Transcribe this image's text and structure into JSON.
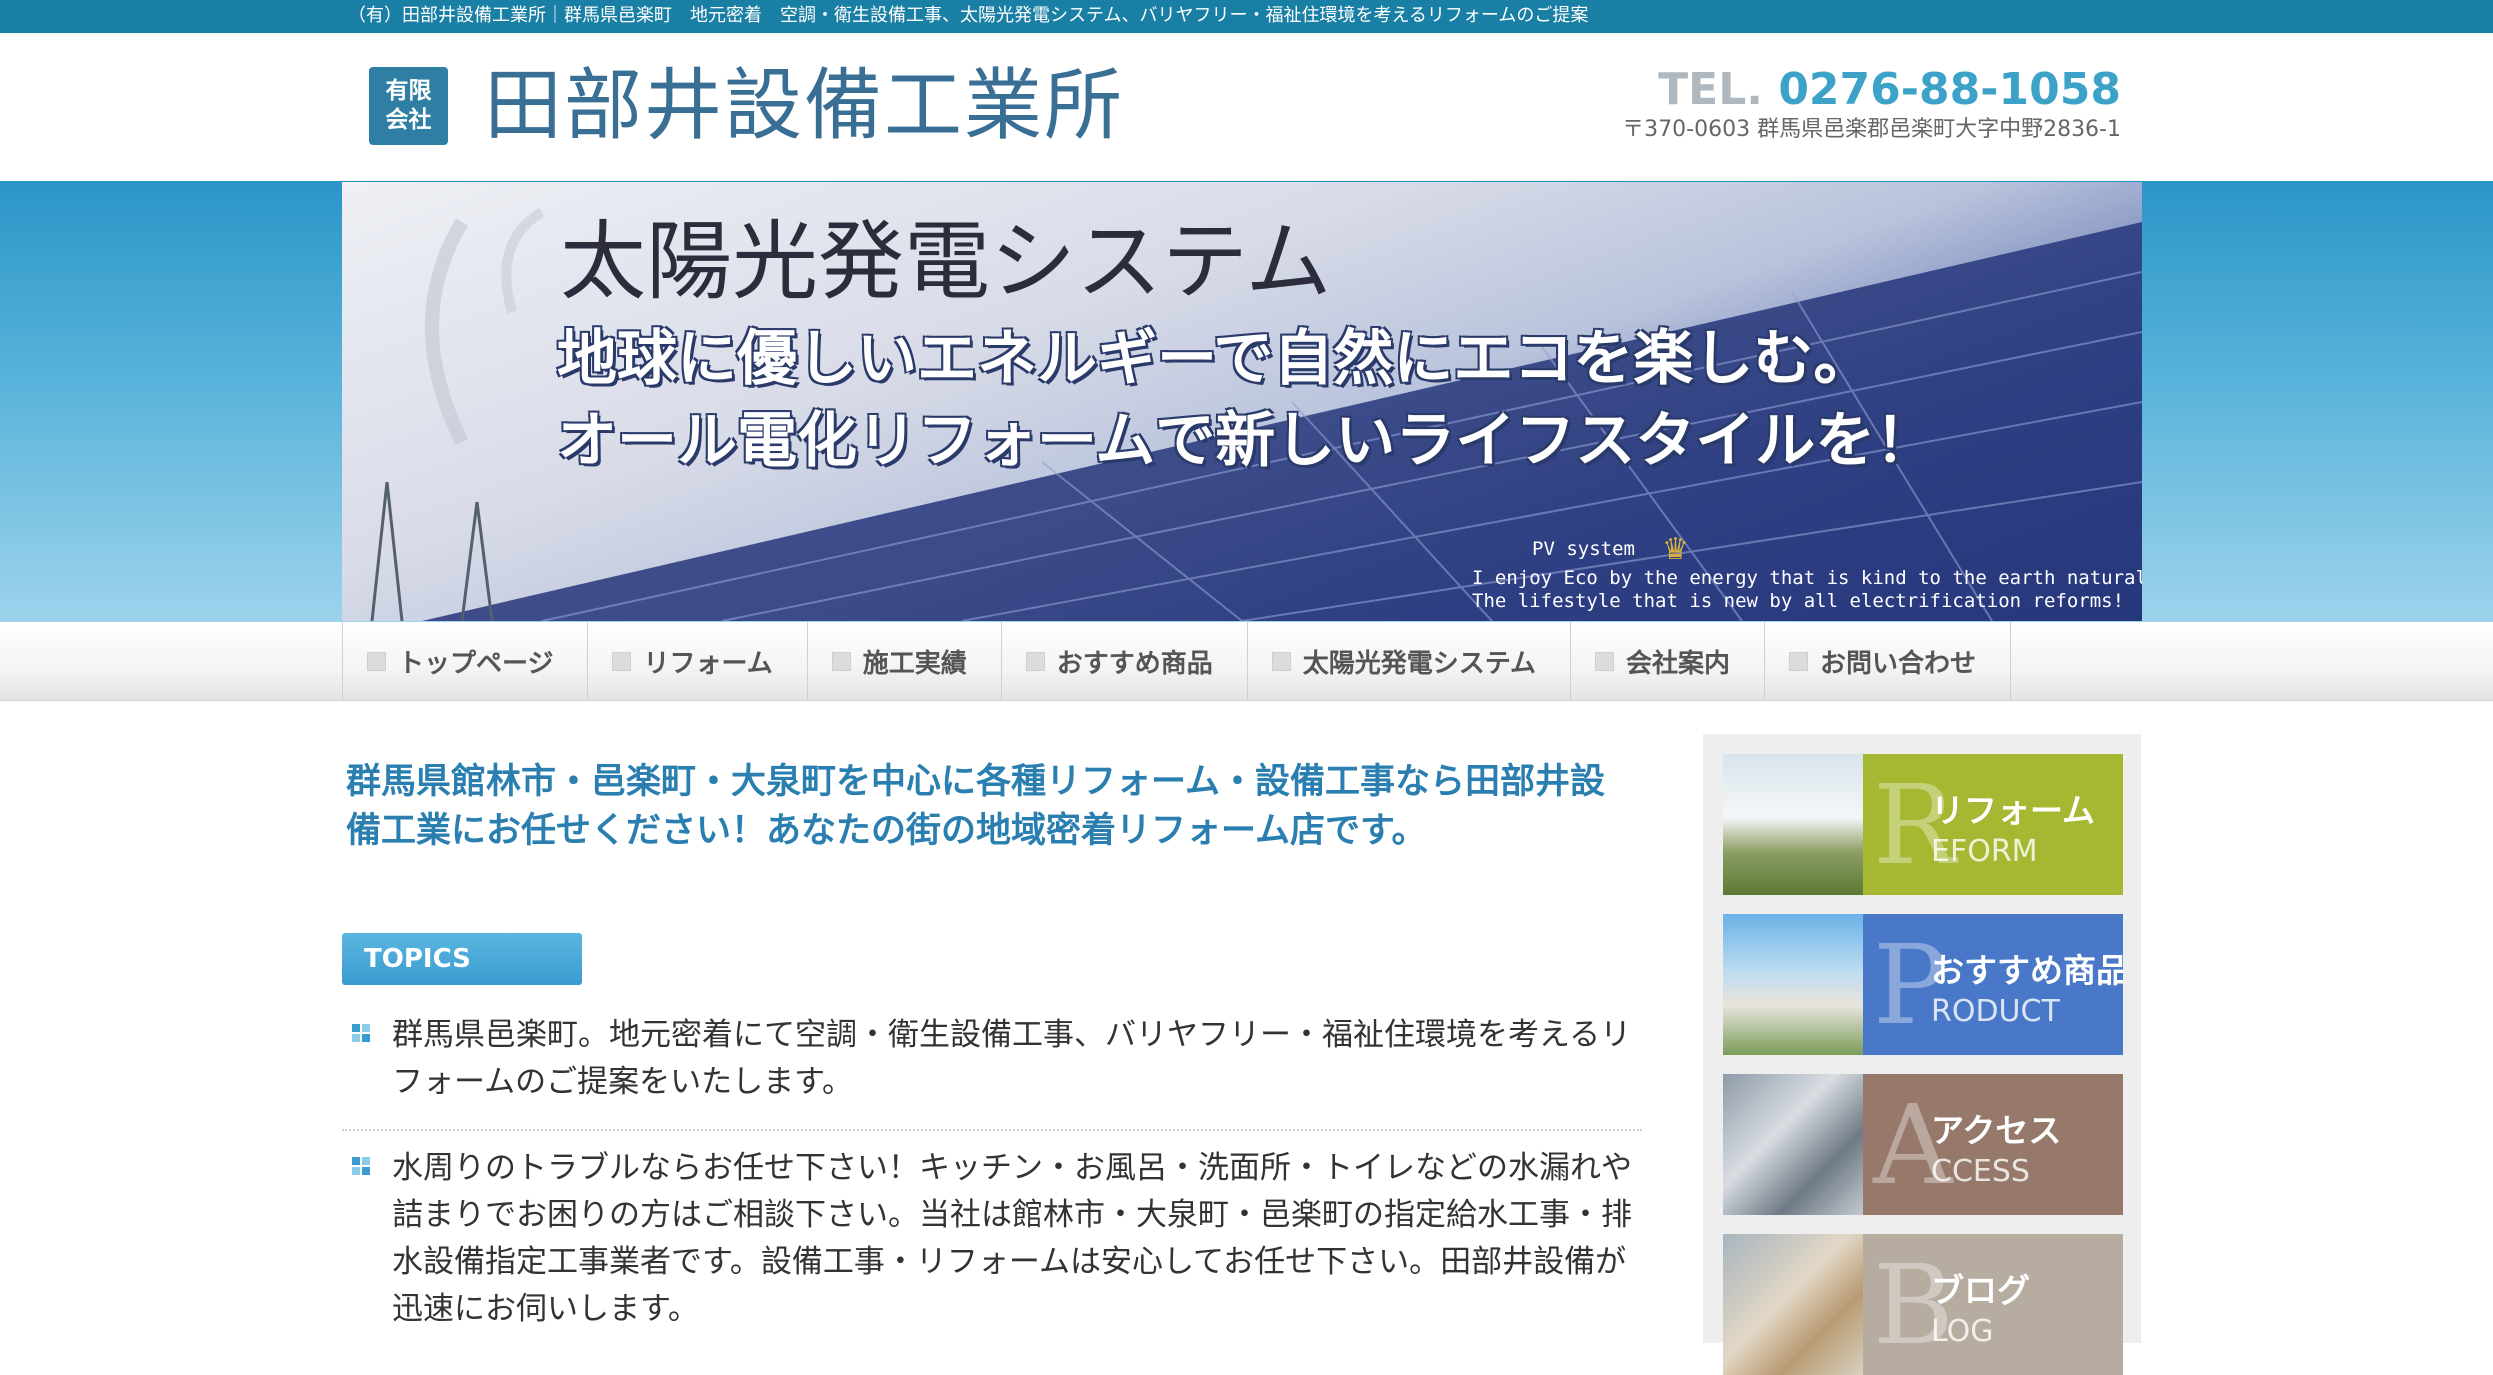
{
  "topbar": {
    "text": "（有）田部井設備工業所｜群馬県邑楽町　地元密着　空調・衛生設備工事、太陽光発電システム、バリヤフリー・福祉住環境を考えるリフォームのご提案"
  },
  "header": {
    "logo_badge_line1": "有限",
    "logo_badge_line2": "会社",
    "company_name": "田部井設備工業所",
    "tel_label": "TEL.",
    "tel_number": "0276-88-1058",
    "address": "〒370-0603 群馬県邑楽郡邑楽町大字中野2836-1"
  },
  "banner": {
    "title": "太陽光発電システム",
    "subtitle1": "地球に優しいエネルギーで自然にエコを楽しむ。",
    "subtitle2": "オール電化リフォームで新しいライフスタイルを！",
    "pv_label": "PV system",
    "english1": "I enjoy Eco by the energy that is kind to the earth naturally.",
    "english2": "The lifestyle that is new by all electrification reforms!"
  },
  "nav": {
    "items": [
      {
        "label": "トップページ"
      },
      {
        "label": "リフォーム"
      },
      {
        "label": "施工実績"
      },
      {
        "label": "おすすめ商品"
      },
      {
        "label": "太陽光発電システム"
      },
      {
        "label": "会社案内"
      },
      {
        "label": "お問い合わせ"
      }
    ]
  },
  "main": {
    "headline": "群馬県館林市・邑楽町・大泉町を中心に各種リフォーム・設備工事なら田部井設備工業にお任せください！あなたの街の地域密着リフォーム店です。",
    "topics_label": "TOPICS",
    "topics": [
      {
        "text": "群馬県邑楽町。地元密着にて空調・衛生設備工事、バリヤフリー・福祉住環境を考えるリフォームのご提案をいたします。"
      },
      {
        "text": "水周りのトラブルならお任せ下さい！キッチン・お風呂・洗面所・トイレなどの水漏れや詰まりでお困りの方はご相談下さい。当社は館林市・大泉町・邑楽町の指定給水工事・排水設備指定工事業者です。設備工事・リフォームは安心してお任せ下さい。田部井設備が迅速にお伺いします。"
      }
    ]
  },
  "sidebar": {
    "cards": [
      {
        "letter": "R",
        "jp": "リフォーム",
        "en": "EFORM",
        "color": "#a6b832"
      },
      {
        "letter": "P",
        "jp": "おすすめ商品",
        "en": "RODUCT",
        "color": "#4a78c8"
      },
      {
        "letter": "A",
        "jp": "アクセス",
        "en": "CCESS",
        "color": "#96796a"
      },
      {
        "letter": "B",
        "jp": "ブログ",
        "en": "LOG",
        "color": "#b6ada0"
      }
    ]
  },
  "colors": {
    "brand": "#1a7fa4",
    "tel": "#3da2c8",
    "headline": "#2a7fb0"
  }
}
